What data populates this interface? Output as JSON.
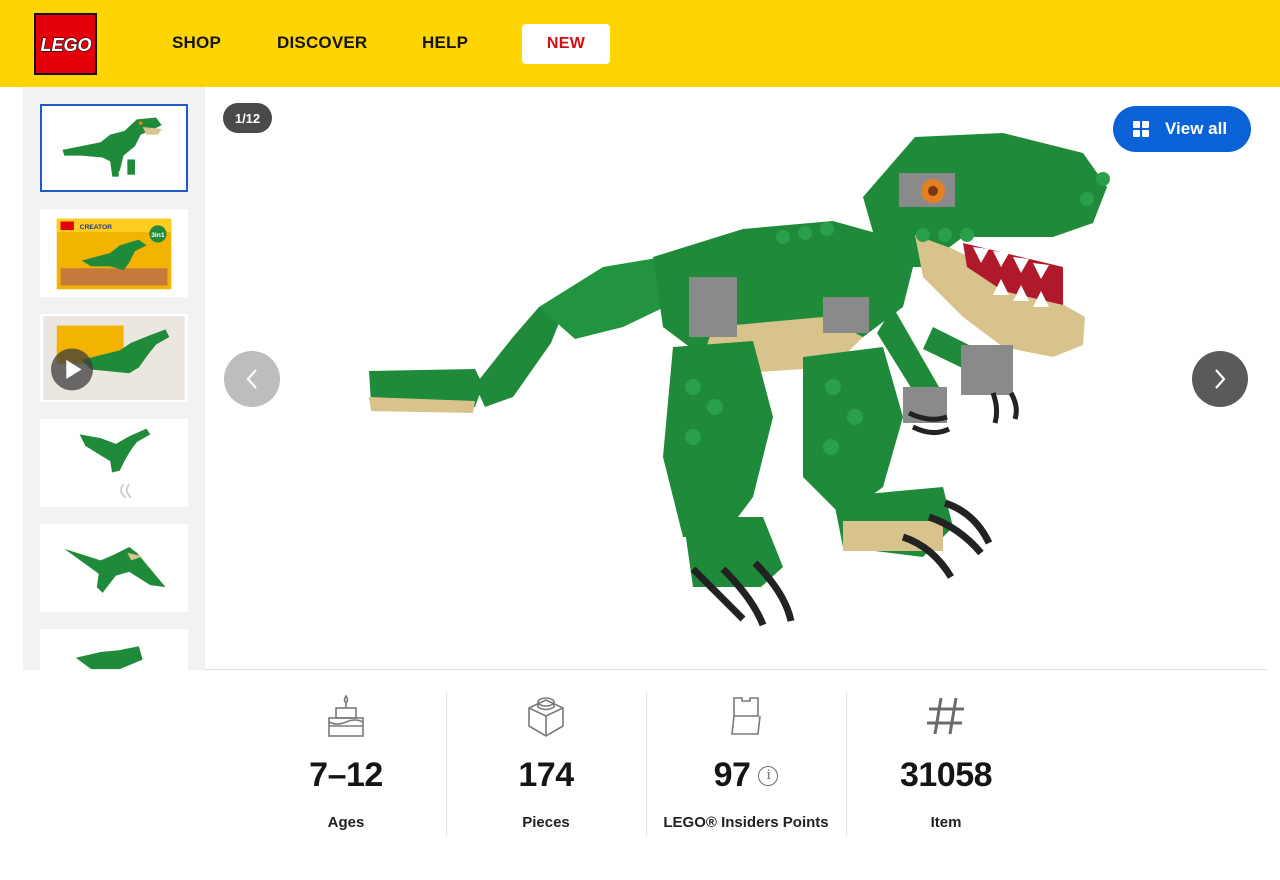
{
  "header": {
    "logo_text": "LEGO",
    "nav": [
      "SHOP",
      "DISCOVER",
      "HELP"
    ],
    "new_label": "NEW"
  },
  "gallery": {
    "counter": "1/12",
    "view_all_label": "View all",
    "thumbnails": [
      {
        "name": "thumbnail-dinosaur-side",
        "active": true
      },
      {
        "name": "thumbnail-box-front",
        "active": false
      },
      {
        "name": "thumbnail-video",
        "active": false,
        "has_play_icon": true
      },
      {
        "name": "thumbnail-dinosaur-small",
        "active": false
      },
      {
        "name": "thumbnail-pterodactyl",
        "active": false
      },
      {
        "name": "thumbnail-partial",
        "active": false
      }
    ],
    "box_text": "CREATOR",
    "box_badge": "3in1"
  },
  "stats": {
    "ages": {
      "value": "7–12",
      "label": "Ages",
      "icon": "cake-icon"
    },
    "pieces": {
      "value": "174",
      "label": "Pieces",
      "icon": "brick-icon"
    },
    "points": {
      "value": "97",
      "label": "LEGO® Insiders Points",
      "icon": "insiders-icon"
    },
    "item": {
      "value": "31058",
      "label": "Item",
      "icon": "hash-icon"
    }
  },
  "colors": {
    "header_bg": "#ffd500",
    "logo_red": "#e3000b",
    "new_text": "#d01012",
    "primary_blue": "#0a62d6",
    "dino_green": "#1f8b3a"
  }
}
